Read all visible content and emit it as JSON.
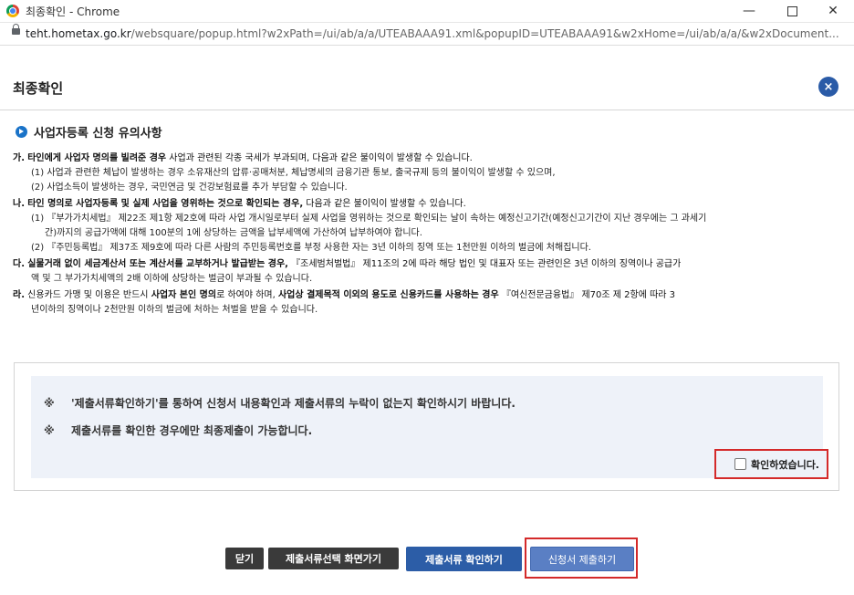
{
  "window": {
    "title": "최종확인 - Chrome",
    "min_label": "—",
    "close_label": "✕",
    "url_host": "teht.hometax.go.kr",
    "url_path": "/websquare/popup.html?w2xPath=/ui/ab/a/a/UTEABAAA91.xml&popupID=UTEABAAA91&w2xHome=/ui/ab/a/a/&w2xDocument..."
  },
  "popup": {
    "title": "최종확인",
    "close_label": "×",
    "section_title": "사업자등록 신청 유의사항"
  },
  "notices": [
    {
      "marker": "가.",
      "bold": "타인에게 사업자 명의를 빌려준 경우",
      "text": " 사업과 관련된 각종 국세가 부과되며, 다음과 같은 불이익이 발생할 수 있습니다.",
      "subs": [
        "(1) 사업과 관련한 체납이 발생하는 경우 소유재산의 압류·공매처분, 체납명세의 금융기관 통보, 출국규제 등의 불이익이 발생할 수 있으며,",
        "(2) 사업소득이 발생하는 경우, 국민연금 및 건강보험료를 추가 부담할 수 있습니다."
      ]
    },
    {
      "marker": "나.",
      "bold": "타인 명의로 사업자등록 및 실제 사업을 영위하는 것으로 확인되는 경우,",
      "text": " 다음과 같은 불이익이 발생할 수 있습니다.",
      "subs": [
        "(1) 『부가가치세법』 제22조 제1항 제2호에 따라 사업 개시일로부터 실제 사업을 영위하는 것으로 확인되는 날이 속하는 예정신고기간(예정신고기간이 지난 경우에는 그 과세기",
        "간)까지의 공급가액에 대해 100분의 1에 상당하는 금액을 납부세액에 가산하여 납부하여야 합니다.",
        "(2) 『주민등록법』 제37조 제9호에 따라 다른 사람의 주민등록번호를 부정 사용한 자는 3년 이하의 징역 또는 1천만원 이하의 벌금에 처해집니다."
      ]
    },
    {
      "marker": "다.",
      "bold": "실물거래 없이 세금계산서 또는 계산서를 교부하거나 발급받는 경우,",
      "text": " 『조세범처벌법』 제11조의 2에 따라 해당 법인 및 대표자 또는 관련인은 3년 이하의 징역이나 공급가",
      "subs": [
        "액 및 그 부가가치세액의 2배 이하에 상당하는 벌금이 부과될 수 있습니다."
      ]
    },
    {
      "marker": "라.",
      "text_a": " 신용카드 가맹 및 이용은 반드시 ",
      "bold_a": "사업자 본인 명의",
      "text_b": "로 하여야 하며, ",
      "bold_b": "사업상 결제목적 이외의 용도로 신용카드를 사용하는 경우",
      "text_c": " 『여신전문금융법』 제70조 제 2항에 따라 3",
      "subs": [
        "년이하의 징역이나 2천만원 이하의 벌금에 처하는 처벌을 받을 수 있습니다."
      ]
    }
  ],
  "confirm": {
    "mark": "※",
    "line1": "'제출서류확인하기'를 통하여 신청서 내용확인과 제출서류의 누락이 없는지 확인하시기 바랍니다.",
    "line2": "제출서류를 확인한 경우에만 최종제출이 가능합니다.",
    "checkbox_label": "확인하였습니다.",
    "checked": false
  },
  "buttons": {
    "close": "닫기",
    "select_docs": "제출서류선택 화면가기",
    "check_docs": "제출서류 확인하기",
    "submit": "신청서 제출하기"
  }
}
